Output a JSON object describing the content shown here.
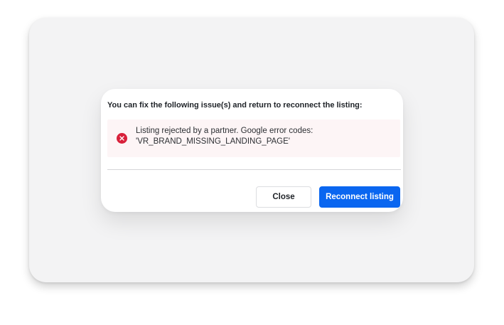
{
  "dialog": {
    "heading": "You can fix the following issue(s) and return to reconnect the listing:",
    "alert": {
      "icon": "error-icon",
      "line1": "Listing rejected by a partner. Google error codes:",
      "line2": "'VR_BRAND_MISSING_LANDING_PAGE'"
    },
    "buttons": {
      "close_label": "Close",
      "primary_label": "Reconnect listing"
    }
  },
  "colors": {
    "primary": "#0a66f0",
    "error": "#d8213b",
    "alert_background": "#fdf5f6",
    "backdrop": "#f3f3f4"
  }
}
